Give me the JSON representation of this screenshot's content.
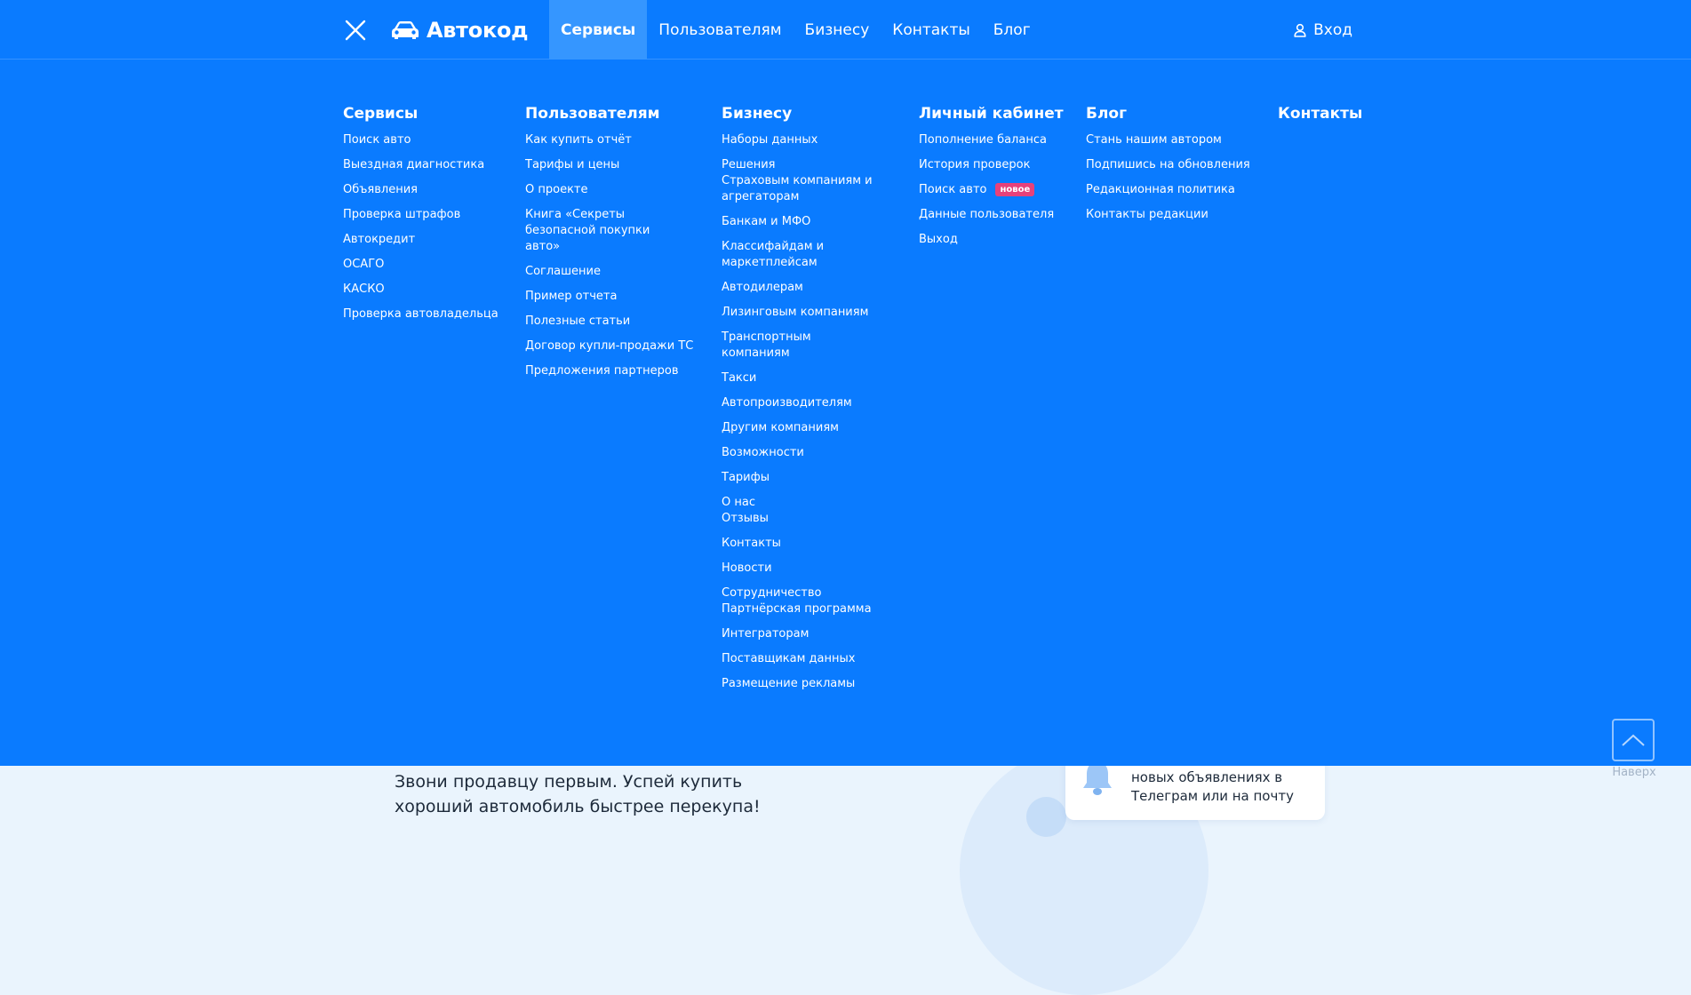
{
  "header": {
    "logo_text": "Автокод",
    "nav": [
      "Сервисы",
      "Пользователям",
      "Бизнесу",
      "Контакты",
      "Блог"
    ],
    "login_label": "Вход"
  },
  "columns": [
    {
      "title": "Сервисы",
      "items": [
        "Поиск авто",
        "Выездная диагностика",
        "Объявления",
        "Проверка штрафов",
        "Автокредит",
        "ОСАГО",
        "КАСКО",
        "Проверка автовладельца"
      ]
    },
    {
      "title": "Пользователям",
      "items": [
        "Как купить отчёт",
        "Тарифы и цены",
        "О проекте",
        "Книга «Секреты безопасной покупки авто»",
        "Соглашение",
        "Пример отчета",
        "Полезные статьи",
        "Договор купли-продажи ТС",
        "Предложения партнеров"
      ]
    },
    {
      "title": "Бизнесу",
      "items": [
        "Наборы данных",
        "Решения",
        "Банкам и МФО",
        "Классифайдам и маркетплейсам",
        "Автодилерам",
        "Лизинговым компаниям",
        "Транспортным компаниям",
        "Такси",
        "Автопроизводителям",
        "Другим компаниям",
        "Возможности",
        "Тарифы",
        "О нас",
        "Контакты",
        "Новости",
        "Сотрудничество",
        "Интеграторам",
        "Поставщикам данных",
        "Размещение рекламы"
      ],
      "subitems": {
        "insurance": "Страховым компаниям и агрегаторам",
        "reviews": "Отзывы",
        "partner_program": "Партнёрская программа"
      }
    },
    {
      "title": "Личный кабинет",
      "items": [
        "Пополнение баланса",
        "История проверок",
        "Поиск авто",
        "Данные пользователя",
        "Выход"
      ],
      "badge": "новое"
    },
    {
      "title": "Блог",
      "items": [
        "Стань нашим автором",
        "Подпишись на обновления",
        "Редакционная политика",
        "Контакты редакции"
      ]
    },
    {
      "title": "Контакты",
      "items": []
    }
  ],
  "promo": {
    "line1": "Звони продавцу первым. Успей купить",
    "line2": "хороший автомобиль быстрее перекупа!"
  },
  "notify": {
    "line1": "новых объявлениях в",
    "line2": "Телеграм или на почту"
  },
  "to_top_label": "Наверх",
  "colors": {
    "brand_blue": "#0a7bff",
    "active_tab": "#3596ff",
    "badge": "#e8417a"
  }
}
